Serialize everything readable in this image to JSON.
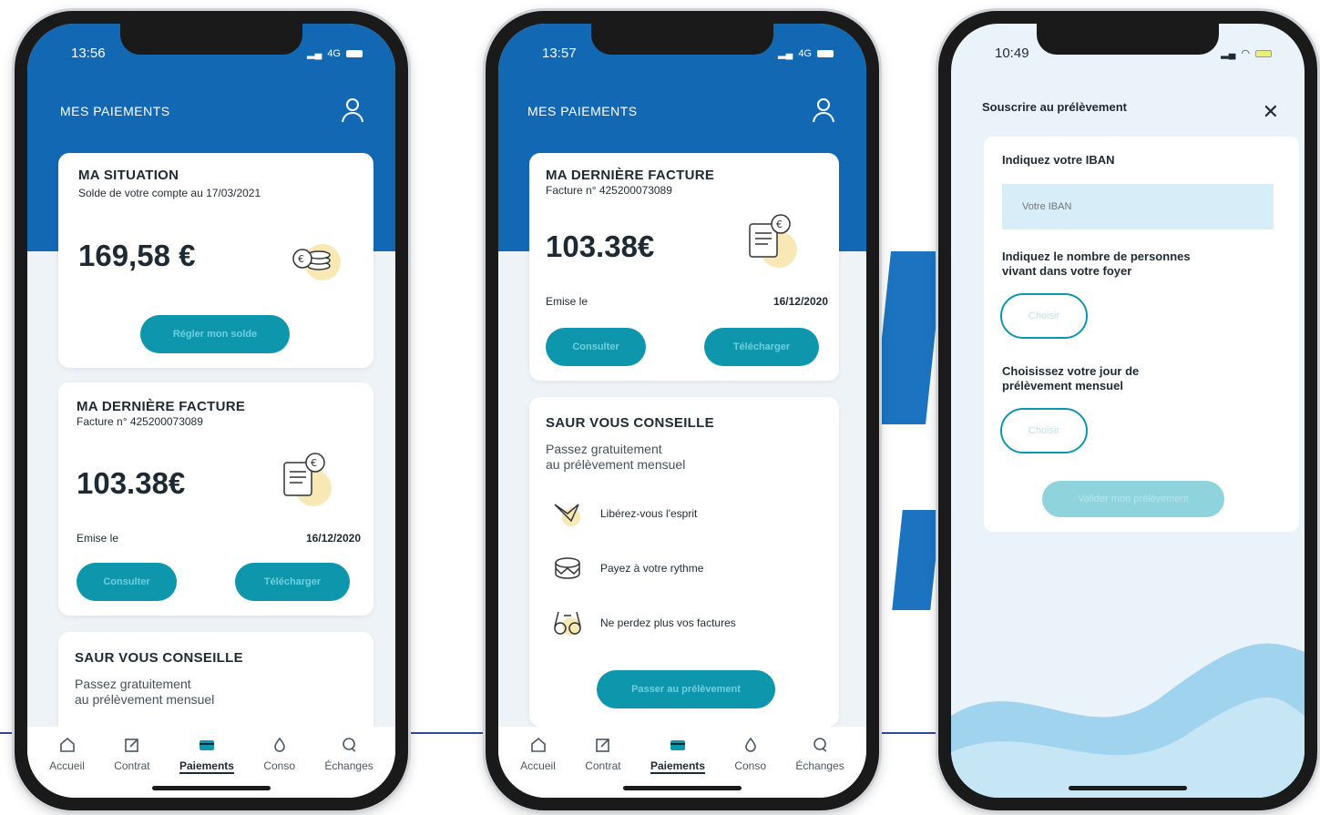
{
  "colors": {
    "brand_blue": "#1268b3",
    "accent_teal": "#0e96ad",
    "background_light": "#eef3f7"
  },
  "tabs": [
    {
      "label": "Accueil",
      "icon": "home-icon"
    },
    {
      "label": "Contrat",
      "icon": "edit-icon"
    },
    {
      "label": "Paiements",
      "icon": "card-icon"
    },
    {
      "label": "Conso",
      "icon": "drop-icon"
    },
    {
      "label": "Échanges",
      "icon": "chat-icon"
    }
  ],
  "phone1": {
    "time": "13:56",
    "network": "4G",
    "header_title": "MES PAIEMENTS",
    "situation": {
      "title": "MA SITUATION",
      "subtitle": "Solde de votre compte au 17/03/2021",
      "amount": "169,58 €",
      "button": "Régler mon solde"
    },
    "invoice": {
      "title": "MA DERNIÈRE FACTURE",
      "number": "Facture n° 425200073089",
      "amount": "103.38€",
      "issued_label": "Emise le",
      "issued_date": "16/12/2020",
      "consult_button": "Consulter",
      "download_button": "Télécharger"
    },
    "advice": {
      "title": "SAUR VOUS CONSEILLE",
      "text_line1": "Passez gratuitement",
      "text_line2": "au prélèvement mensuel"
    }
  },
  "phone2": {
    "time": "13:57",
    "network": "4G",
    "header_title": "MES PAIEMENTS",
    "invoice": {
      "title": "MA DERNIÈRE FACTURE",
      "number": "Facture n° 425200073089",
      "amount": "103.38€",
      "issued_label": "Emise le",
      "issued_date": "16/12/2020",
      "consult_button": "Consulter",
      "download_button": "Télécharger"
    },
    "advice": {
      "title": "SAUR VOUS CONSEILLE",
      "text_line1": "Passez gratuitement",
      "text_line2": "au prélèvement mensuel",
      "benefits": [
        "Libérez-vous l'esprit",
        "Payez à votre rythme",
        "Ne perdez plus vos factures"
      ],
      "button": "Passer au prélèvement"
    }
  },
  "phone3": {
    "time": "10:49",
    "header_title": "Souscrire au prélèvement",
    "iban_label": "Indiquez votre IBAN",
    "iban_placeholder": "Votre IBAN",
    "household_label_line1": "Indiquez le nombre de personnes",
    "household_label_line2": "vivant dans votre foyer",
    "household_choice": "Choisir",
    "day_label_line1": "Choisissez votre jour de",
    "day_label_line2": "prélèvement mensuel",
    "day_choice": "Choisir",
    "validate_button": "Valider mon prélèvement"
  }
}
